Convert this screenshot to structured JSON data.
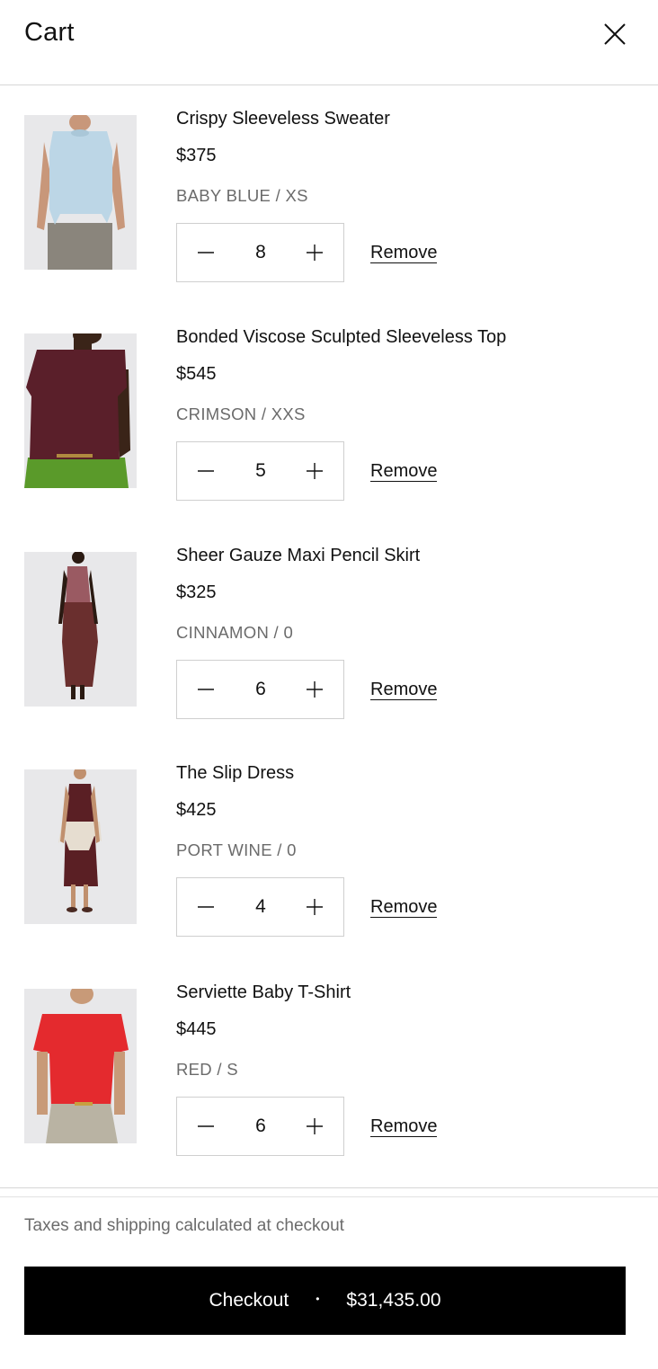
{
  "header": {
    "title": "Cart",
    "close_icon": "close-icon"
  },
  "items": [
    {
      "name": "Crispy Sleeveless Sweater",
      "price": "$375",
      "variant": "BABY BLUE / XS",
      "quantity": "8",
      "remove_label": "Remove",
      "garment_color": "#bcd6e6",
      "bottom_color": "#8a857c"
    },
    {
      "name": "Bonded Viscose Sculpted Sleeveless Top",
      "price": "$545",
      "variant": "CRIMSON / XXS",
      "quantity": "5",
      "remove_label": "Remove",
      "garment_color": "#5a1f2a",
      "bottom_color": "#5a9a2a"
    },
    {
      "name": "Sheer Gauze Maxi Pencil Skirt",
      "price": "$325",
      "variant": "CINNAMON / 0",
      "quantity": "6",
      "remove_label": "Remove",
      "garment_color": "#6a2f2e",
      "bottom_color": "#6a2f2e"
    },
    {
      "name": "The Slip Dress",
      "price": "$425",
      "variant": "PORT WINE / 0",
      "quantity": "4",
      "remove_label": "Remove",
      "garment_color": "#5a1f24",
      "bottom_color": "#5a1f24"
    },
    {
      "name": "Serviette Baby T-Shirt",
      "price": "$445",
      "variant": "RED / S",
      "quantity": "6",
      "remove_label": "Remove",
      "garment_color": "#e42a2e",
      "bottom_color": "#b9b3a3"
    }
  ],
  "footer": {
    "note": "Taxes and shipping calculated at checkout",
    "checkout_label": "Checkout",
    "separator": "•",
    "total": "$31,435.00"
  },
  "colors": {
    "button_bg": "#000000",
    "text": "#111111",
    "muted": "#6b6b6b",
    "border": "#cfcfcf"
  }
}
